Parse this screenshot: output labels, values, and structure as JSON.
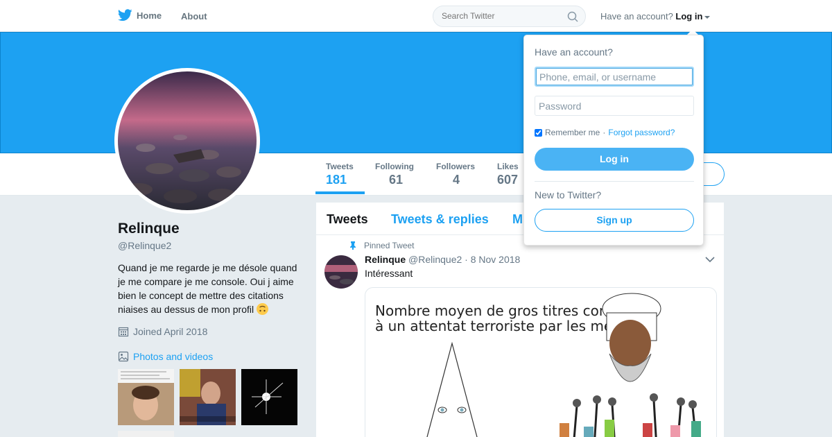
{
  "nav": {
    "home_label": "Home",
    "about_label": "About",
    "search_placeholder": "Search Twitter",
    "have_account": "Have an account?",
    "login_label": "Log in"
  },
  "profile": {
    "name": "Relinque",
    "handle": "@Relinque2",
    "bio": "Quand je me regarde je me désole quand je me compare je me console. Oui j aime bien le concept de mettre des citations niaises au dessus de mon profil",
    "joined": "Joined April 2018",
    "photos_label": "Photos and videos"
  },
  "stats": [
    {
      "label": "Tweets",
      "value": "181"
    },
    {
      "label": "Following",
      "value": "61"
    },
    {
      "label": "Followers",
      "value": "4"
    },
    {
      "label": "Likes",
      "value": "607"
    }
  ],
  "tabs": {
    "tweets": "Tweets",
    "replies": "Tweets & replies",
    "media": "M"
  },
  "tweet": {
    "pinned_label": "Pinned Tweet",
    "name": "Relinque",
    "handle": "@Relinque2",
    "date": "· 8 Nov 2018",
    "text": "Intéressant",
    "media_caption_line1": "Nombre moyen de gros titres consacrés",
    "media_caption_line2": "à un attentat terroriste par les médias"
  },
  "login": {
    "title": "Have an account?",
    "username_placeholder": "Phone, email, or username",
    "password_placeholder": "Password",
    "remember": "Remember me",
    "separator": "·",
    "forgot": "Forgot password?",
    "login_button": "Log in",
    "new_to": "New to Twitter?",
    "signup_button": "Sign up"
  },
  "colors": {
    "accent": "#1da1f2",
    "banner": "#1da1f2",
    "background": "#e6ecf0"
  }
}
